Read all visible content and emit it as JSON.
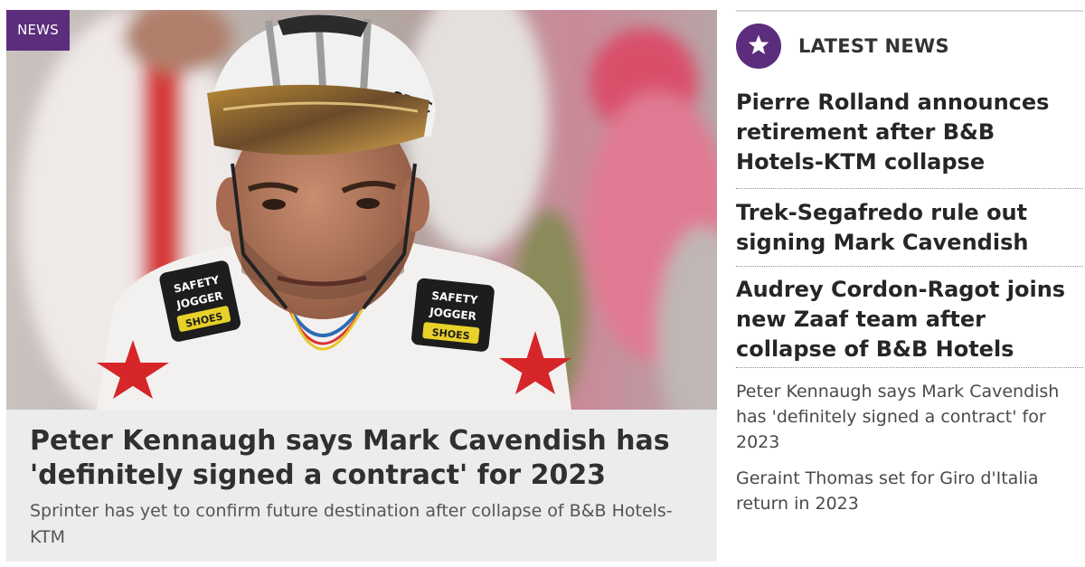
{
  "feature": {
    "tag": "NEWS",
    "headline": "Peter Kennaugh says Mark Cavendish has 'definitely signed a contract' for 2023",
    "standfirst": "Sprinter has yet to confirm future destination after collapse of B&B Hotels-KTM",
    "image": {
      "helmet_brand": "SPEC",
      "jersey_sponsor_line1": "SAFETY",
      "jersey_sponsor_line2": "JOGGER",
      "jersey_sponsor_line3": "SHOES"
    }
  },
  "sidebar": {
    "title": "LATEST NEWS",
    "icon": "star-icon",
    "items": [
      {
        "label": "Pierre Rolland announces retirement after B&B Hotels-KTM collapse",
        "style": "bold"
      },
      {
        "label": "Trek-Segafredo rule out signing Mark Cavendish",
        "style": "bold"
      },
      {
        "label": "Audrey Cordon-Ragot joins new Zaaf team after collapse of B&B Hotels",
        "style": "bold"
      },
      {
        "label": "Peter Kennaugh says Mark Cavendish has 'definitely signed a contract' for 2023",
        "style": "regular"
      },
      {
        "label": "Geraint Thomas set for Giro d'Italia return in 2023",
        "style": "regular"
      }
    ]
  },
  "colors": {
    "accent": "#5c2d7c",
    "caption_bg": "#ececec",
    "headline": "#303030"
  }
}
